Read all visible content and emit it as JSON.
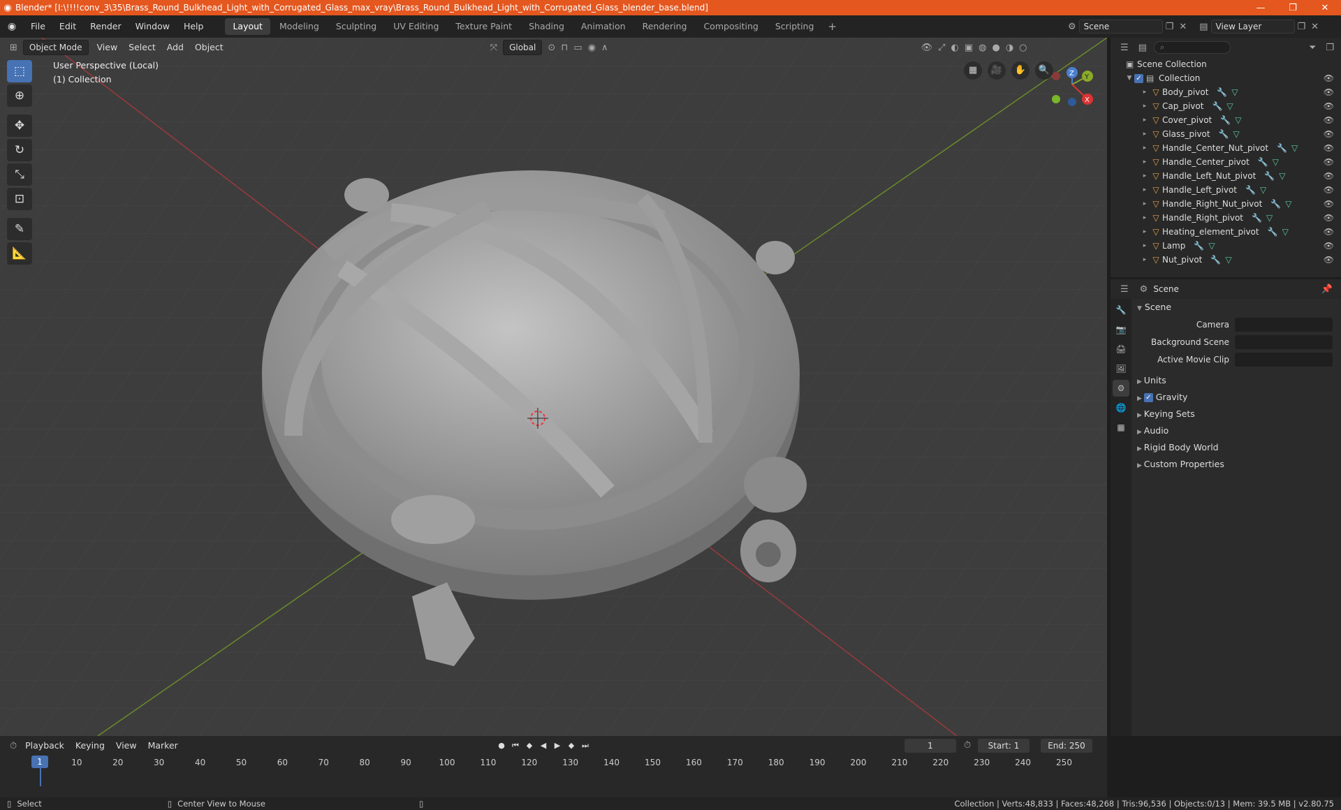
{
  "window": {
    "title": "Blender* [I:\\!!!!conv_3\\35\\Brass_Round_Bulkhead_Light_with_Corrugated_Glass_max_vray\\Brass_Round_Bulkhead_Light_with_Corrugated_Glass_blender_base.blend]",
    "minimize": "—",
    "maximize": "❐",
    "close": "✕"
  },
  "menu": [
    "File",
    "Edit",
    "Render",
    "Window",
    "Help"
  ],
  "workspaces": [
    "Layout",
    "Modeling",
    "Sculpting",
    "UV Editing",
    "Texture Paint",
    "Shading",
    "Animation",
    "Rendering",
    "Compositing",
    "Scripting"
  ],
  "active_workspace": "Layout",
  "scene_name": "Scene",
  "view_layer": "View Layer",
  "viewport": {
    "mode": "Object Mode",
    "menus": [
      "View",
      "Select",
      "Add",
      "Object"
    ],
    "orientation": "Global",
    "perspective": "User Perspective (Local)",
    "collection": "(1) Collection",
    "gizmo": {
      "x": "X",
      "y": "Y",
      "z": "Z"
    }
  },
  "outliner": {
    "root": "Scene Collection",
    "collection": "Collection",
    "items": [
      "Body_pivot",
      "Cap_pivot",
      "Cover_pivot",
      "Glass_pivot",
      "Handle_Center_Nut_pivot",
      "Handle_Center_pivot",
      "Handle_Left_Nut_pivot",
      "Handle_Left_pivot",
      "Handle_Right_Nut_pivot",
      "Handle_Right_pivot",
      "Heating_element_pivot",
      "Lamp",
      "Nut_pivot"
    ]
  },
  "properties": {
    "context": "Scene",
    "panel": "Scene",
    "fields": [
      {
        "label": "Camera",
        "value": ""
      },
      {
        "label": "Background Scene",
        "value": ""
      },
      {
        "label": "Active Movie Clip",
        "value": ""
      }
    ],
    "subpanels": [
      "Units",
      "Gravity",
      "Keying Sets",
      "Audio",
      "Rigid Body World",
      "Custom Properties"
    ]
  },
  "timeline": {
    "menus": [
      "Playback",
      "Keying",
      "View",
      "Marker"
    ],
    "current_frame": "1",
    "start_label": "Start:",
    "start": "1",
    "end_label": "End:",
    "end": "250",
    "ticks": [
      "10",
      "20",
      "30",
      "40",
      "50",
      "60",
      "70",
      "80",
      "90",
      "100",
      "110",
      "120",
      "130",
      "140",
      "150",
      "160",
      "170",
      "180",
      "190",
      "200",
      "210",
      "220",
      "230",
      "240",
      "250"
    ]
  },
  "status": {
    "left": "Select",
    "middle": "Center View to Mouse",
    "right": "Collection | Verts:48,833 | Faces:48,268 | Tris:96,536 | Objects:0/13 | Mem: 39.5 MB | v2.80.75"
  }
}
